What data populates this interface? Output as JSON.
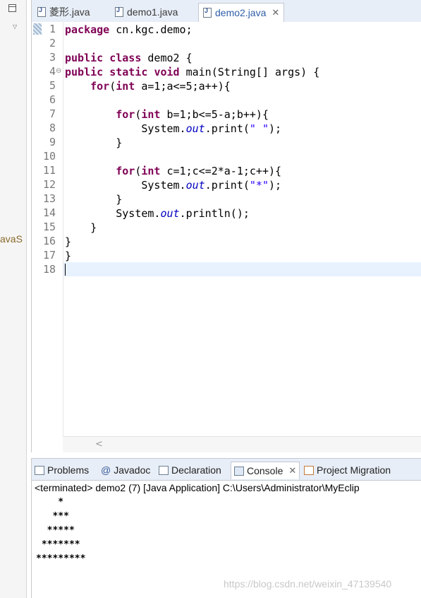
{
  "left_panel": {
    "truncated_text": "avaS"
  },
  "editor": {
    "tabs": [
      {
        "label": "菱形.java",
        "active": false
      },
      {
        "label": "demo1.java",
        "active": false
      },
      {
        "label": "demo2.java",
        "active": true
      }
    ],
    "close_glyph": "✕",
    "line_numbers": [
      "1",
      "2",
      "3",
      "4",
      "5",
      "6",
      "7",
      "8",
      "9",
      "10",
      "11",
      "12",
      "13",
      "14",
      "15",
      "16",
      "17",
      "18"
    ],
    "code": {
      "l1": {
        "kw": "package",
        "rest": " cn.kgc.demo;"
      },
      "l3": {
        "kw1": "public",
        "kw2": "class",
        "rest": " demo2 {"
      },
      "l4": {
        "kw1": "public",
        "kw2": "static",
        "kw3": "void",
        "rest": " main(String[] args) {"
      },
      "l5": {
        "indent": "    ",
        "kw1": "for",
        "mid": "(",
        "kw2": "int",
        "rest": " a=1;a<=5;a++){"
      },
      "l7": {
        "indent": "        ",
        "kw1": "for",
        "mid": "(",
        "kw2": "int",
        "rest": " b=1;b<=5-a;b++){"
      },
      "l8": {
        "pre": "            System.",
        "fld": "out",
        "mid": ".print(",
        "str": "\" \"",
        "post": ");"
      },
      "l9": {
        "text": "        }"
      },
      "l11": {
        "indent": "        ",
        "kw1": "for",
        "mid": "(",
        "kw2": "int",
        "rest": " c=1;c<=2*a-1;c++){"
      },
      "l12": {
        "pre": "            System.",
        "fld": "out",
        "mid": ".print(",
        "str": "\"*\"",
        "post": ");"
      },
      "l13": {
        "text": "        }"
      },
      "l14": {
        "pre": "        System.",
        "fld": "out",
        "post": ".println();"
      },
      "l15": {
        "text": "    }"
      },
      "l16": {
        "text": "}"
      },
      "l17": {
        "text": "}"
      }
    }
  },
  "console": {
    "tabs": [
      {
        "label": "Problems"
      },
      {
        "label": "Javadoc",
        "icon_glyph": "@"
      },
      {
        "label": "Declaration"
      },
      {
        "label": "Console",
        "active": true
      },
      {
        "label": "Project Migration"
      }
    ],
    "status": "<terminated> demo2 (7) [Java Application] C:\\Users\\Administrator\\MyEclip",
    "output": [
      "    *",
      "   ***",
      "  *****",
      " *******",
      "*********"
    ],
    "watermark": "https://blog.csdn.net/weixin_47139540"
  }
}
